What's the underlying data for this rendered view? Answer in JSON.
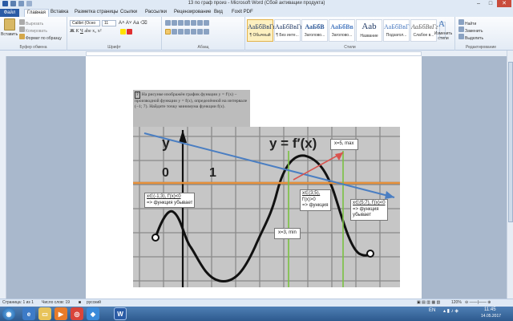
{
  "window": {
    "title": "13 по граф произ - Microsoft Word (Сбой активации продукта)",
    "minimize": "–",
    "maximize": "□",
    "close": "✕"
  },
  "tabs": [
    "Файл",
    "Главная",
    "Вставка",
    "Разметка страницы",
    "Ссылки",
    "Рассылки",
    "Рецензирование",
    "Вид",
    "Foxit PDF"
  ],
  "ribbon": {
    "clipboard": {
      "paste": "Вставить",
      "cut": "Вырезать",
      "copy": "Копировать",
      "format_painter": "Формат по образцу",
      "label": "Буфер обмена"
    },
    "font": {
      "name": "Calibri (Осно",
      "size": "11",
      "label": "Шрифт"
    },
    "paragraph": {
      "label": "Абзац"
    },
    "styles": {
      "items": [
        {
          "preview": "АаБбВвГг",
          "name": "¶ Обычный"
        },
        {
          "preview": "АаБбВвГг",
          "name": "¶ Без инте..."
        },
        {
          "preview": "АаБбВ",
          "name": "Заголово..."
        },
        {
          "preview": "АаБбВв",
          "name": "Заголово..."
        },
        {
          "preview": "Aab",
          "name": "Название"
        },
        {
          "preview": "АаБбВвГ",
          "name": "Подзагол..."
        },
        {
          "preview": "АаБбВвГг",
          "name": "Слабое в..."
        }
      ],
      "change_styles": "Изменить стили",
      "label": "Стили"
    },
    "editing": {
      "find": "Найти",
      "replace": "Заменить",
      "select": "Выделить",
      "label": "Редактирование"
    }
  },
  "problem": {
    "number": "7",
    "text": "На рисунке изображён график функции y = f′(x) − производной функции y = f(x), определённой на интервале (−1; 7). Найдите точку минимума функции f(x)."
  },
  "graph": {
    "y_label": "y",
    "func_label": "y = f′(x)",
    "tick_zero": "0",
    "tick_one": "1"
  },
  "notes": {
    "n1_line1": "x∈(-1;3), f'(x)<0",
    "n1_line2": "=> функция убывает",
    "n2_line1": "x∈(3;5),",
    "n2_line2": "f'(x)>0",
    "n2_line3": "=> функция",
    "n3": "x=5, max",
    "n4": "x=3, min",
    "n5_line1": "x∈(5;7), f'(x)<0",
    "n5_line2": "=> функция",
    "n5_line3": "убывает"
  },
  "status": {
    "page": "Страница: 1 из 1",
    "words": "Число слов: 19",
    "lang": "русский",
    "zoom": "120%"
  },
  "taskbar": {
    "lang": "EN",
    "time": "11:45",
    "date": "14.05.2017"
  }
}
